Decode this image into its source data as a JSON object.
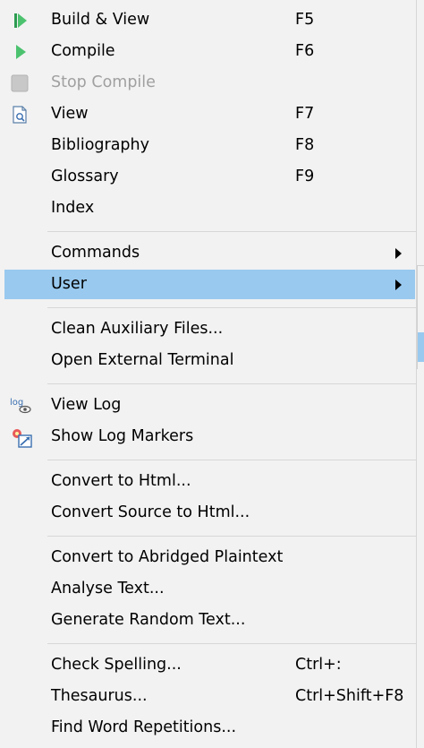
{
  "menu": {
    "group1": [
      {
        "label": "Build & View",
        "shortcut": "F5",
        "icon": "build-view-icon"
      },
      {
        "label": "Compile",
        "shortcut": "F6",
        "icon": "compile-icon"
      },
      {
        "label": "Stop Compile",
        "shortcut": "",
        "icon": "stop-compile-icon",
        "disabled": true
      },
      {
        "label": "View",
        "shortcut": "F7",
        "icon": "view-icon"
      },
      {
        "label": "Bibliography",
        "shortcut": "F8"
      },
      {
        "label": "Glossary",
        "shortcut": "F9"
      },
      {
        "label": "Index",
        "shortcut": ""
      }
    ],
    "group2": [
      {
        "label": "Commands",
        "submenu": true
      },
      {
        "label": "User",
        "submenu": true,
        "highlighted": true
      }
    ],
    "group3": [
      {
        "label": "Clean Auxiliary Files..."
      },
      {
        "label": "Open External Terminal"
      }
    ],
    "group4": [
      {
        "label": "View Log",
        "icon": "view-log-icon"
      },
      {
        "label": "Show Log Markers",
        "icon": "log-markers-icon"
      }
    ],
    "group5": [
      {
        "label": "Convert to Html..."
      },
      {
        "label": "Convert Source to Html..."
      }
    ],
    "group6": [
      {
        "label": "Convert to Abridged Plaintext"
      },
      {
        "label": "Analyse Text..."
      },
      {
        "label": "Generate Random Text..."
      }
    ],
    "group7": [
      {
        "label": "Check Spelling...",
        "shortcut": "Ctrl+:"
      },
      {
        "label": "Thesaurus...",
        "shortcut": "Ctrl+Shift+F8"
      },
      {
        "label": "Find Word Repetitions..."
      }
    ]
  },
  "colors": {
    "background": "#f2f2f2",
    "highlight": "#99c9ef",
    "separator": "#d7d7d7",
    "disabled_text": "#a0a0a0",
    "compile_green": "#3cb371"
  }
}
